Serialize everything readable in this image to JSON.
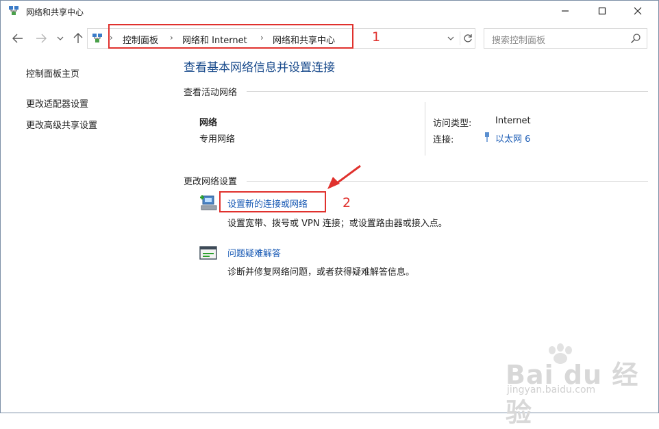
{
  "window": {
    "title": "网络和共享中心"
  },
  "address": {
    "crumbs": [
      "控制面板",
      "网络和 Internet",
      "网络和共享中心"
    ],
    "annotation": "1"
  },
  "search": {
    "placeholder": "搜索控制面板"
  },
  "left_panel": {
    "items": [
      {
        "label": "控制面板主页"
      },
      {
        "label": "更改适配器设置"
      },
      {
        "label": "更改高级共享设置"
      }
    ]
  },
  "main": {
    "title": "查看基本网络信息并设置连接",
    "active_networks_heading": "查看活动网络",
    "network": {
      "name": "网络",
      "type": "专用网络",
      "access_type_label": "访问类型:",
      "access_type_value": "Internet",
      "connection_label": "连接:",
      "connection_value": "以太网 6"
    },
    "change_settings_heading": "更改网络设置",
    "tasks": [
      {
        "link": "设置新的连接或网络",
        "desc": "设置宽带、拨号或 VPN 连接；或设置路由器或接入点。"
      },
      {
        "link": "问题疑难解答",
        "desc": "诊断并修复网络问题，或者获得疑难解答信息。"
      }
    ],
    "annotation": "2"
  },
  "watermark": {
    "brand": "Bai du 经验",
    "url": "jingyan.baidu.com"
  },
  "colors": {
    "link": "#1a5bb5",
    "title": "#1a4b8c",
    "annotation": "#e0312d"
  }
}
